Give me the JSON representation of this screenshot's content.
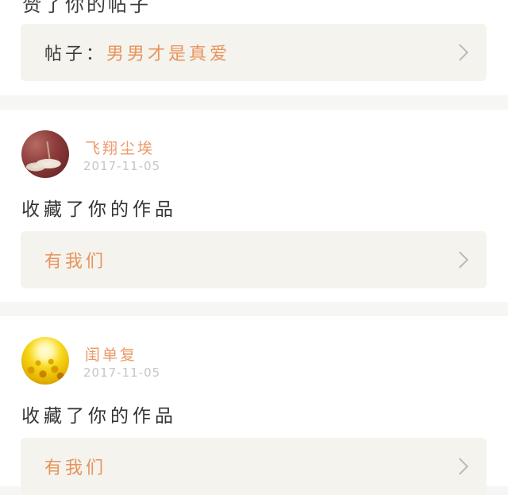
{
  "notifications": [
    {
      "action": "赞了你的帖子",
      "reference_prefix": "帖子：",
      "reference_title": "男男才是真爱"
    },
    {
      "user_name": "飞翔尘埃",
      "date": "2017-11-05",
      "action": "收藏了你的作品",
      "reference_prefix": "",
      "reference_title": "有我们"
    },
    {
      "user_name": "闺单复",
      "date": "2017-11-05",
      "action": "收藏了你的作品",
      "reference_prefix": "",
      "reference_title": "有我们"
    }
  ],
  "colors": {
    "accent_orange": "#e8935a",
    "page_background": "#f6f6f4",
    "reference_box": "#f4f3ee",
    "date_gray": "#c6c6c6"
  },
  "icons": {
    "chevron": "chevron-right-icon"
  }
}
